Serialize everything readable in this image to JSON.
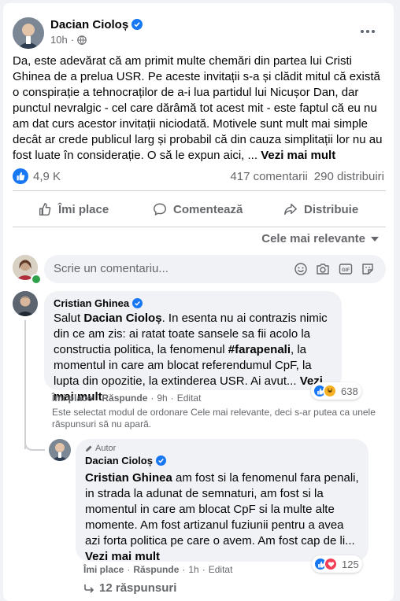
{
  "post": {
    "author": "Dacian Cioloș",
    "time": "10h",
    "text": "Da, este adevărat că am primit multe chemări din partea lui Cristi Ghinea de a prelua USR. Pe aceste invitații s-a și clădit mitul că există o conspirație a tehnocraților de a-i lua partidul lui Nicușor Dan, dar punctul nevralgic - cel care dărâmă tot acest mit - este faptul că eu nu am dat curs acestor invitații niciodată. Motivele sunt mult mai simple decât ar crede publicul larg și probabil că din cauza simplitații lor nu au fost luate în considerație. O să le expun aici, ...",
    "see_more": "Vezi mai mult",
    "reactions_count": "4,9 K",
    "comments_count": "417 comentarii",
    "shares_count": "290 distribuiri"
  },
  "actions": {
    "like": "Îmi place",
    "comment": "Comentează",
    "share": "Distribuie"
  },
  "sort": {
    "label": "Cele mai relevante"
  },
  "composer": {
    "placeholder": "Scrie un comentariu..."
  },
  "comments": [
    {
      "author": "Cristian Ghinea",
      "text_prefix": "Salut ",
      "mention": "Dacian Cioloș",
      "text_a": ". In esenta nu ai contrazis nimic din ce am zis: ai ratat toate sansele sa fii acolo la constructia politica, la fenomenul ",
      "hashtag": "#farapenali",
      "text_b": ", la momentul in care am blocat referendumul CpF, la lupta din opozitie, la extinderea USR. Ai avut...",
      "see_more": "Vezi mai mult",
      "like": "Îmi place",
      "reply": "Răspunde",
      "time": "9h",
      "edited": "Editat",
      "reactions": "638"
    }
  ],
  "sort_notice": "Este selectat modul de ordonare Cele mai relevante, deci s-ar putea ca unele răspunsuri să nu apară.",
  "reply": {
    "badge": "Autor",
    "author": "Dacian Cioloș",
    "mention": "Cristian Ghinea",
    "text": " am fost si la fenomenul fara penali, in strada la adunat de semnaturi, am fost si la momentul in care am blocat CpF si la multe alte momente. Am fost artizanul fuziunii pentru a avea azi forta politica pe care o avem. Am fost cap de li...",
    "see_more": "Vezi mai mult",
    "like": "Îmi place",
    "reply": "Răspunde",
    "time": "1h",
    "edited": "Editat",
    "reactions": "125",
    "replies_link": "12 răspunsuri"
  },
  "colors": {
    "brand": "#1877f2",
    "like_blue": "#1877f2",
    "love_red": "#f33e58",
    "haha_yellow": "#f7b125"
  }
}
